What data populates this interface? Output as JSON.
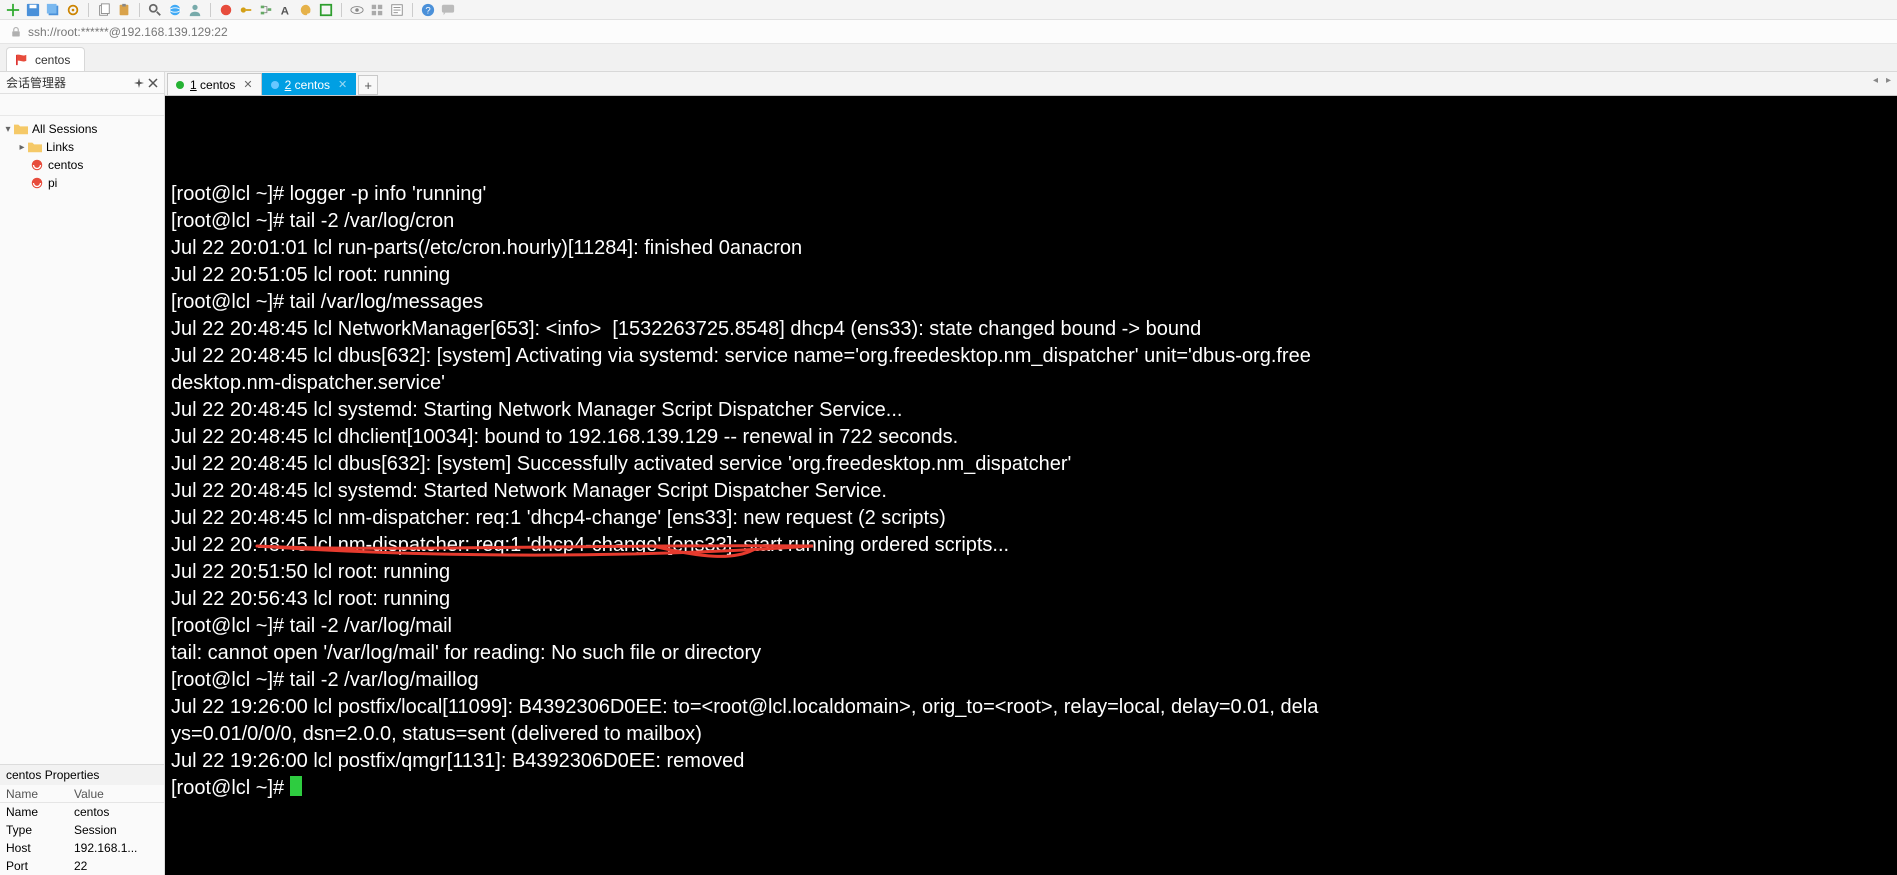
{
  "toolbar_icons": [
    "plus-icon",
    "floppy-icon",
    "floppy-multi-icon",
    "settings-icon",
    "copy-icon",
    "paste-icon",
    "find-icon",
    "globe-icon",
    "users-icon",
    "power-red-icon",
    "key-icon",
    "tree-icon",
    "font-icon",
    "palette-icon",
    "maximize-icon",
    "eye-icon",
    "grid-icon",
    "script-icon",
    "help-icon",
    "chat-icon"
  ],
  "address": {
    "text": "ssh://root:******@192.168.139.129:22"
  },
  "big_tab": {
    "label": "centos"
  },
  "session_manager": {
    "title": "会话管理器",
    "filter_placeholder": "",
    "tree": {
      "root": "All Sessions",
      "links": "Links",
      "items": [
        "centos",
        "pi"
      ]
    }
  },
  "properties": {
    "title": "centos Properties",
    "columns": {
      "name": "Name",
      "value": "Value"
    },
    "rows": [
      {
        "name": "Name",
        "value": "centos"
      },
      {
        "name": "Type",
        "value": "Session"
      },
      {
        "name": "Host",
        "value": "192.168.1..."
      },
      {
        "name": "Port",
        "value": "22"
      }
    ]
  },
  "inner_tabs": {
    "items": [
      {
        "hotkey": "1",
        "label": "centos",
        "active": false
      },
      {
        "hotkey": "2",
        "label": "centos",
        "active": true
      }
    ],
    "new": "+"
  },
  "terminal": {
    "lines": [
      "[root@lcl ~]# logger -p info 'running'",
      "[root@lcl ~]# tail -2 /var/log/cron",
      "Jul 22 20:01:01 lcl run-parts(/etc/cron.hourly)[11284]: finished 0anacron",
      "Jul 22 20:51:05 lcl root: running",
      "[root@lcl ~]# tail /var/log/messages",
      "Jul 22 20:48:45 lcl NetworkManager[653]: <info>  [1532263725.8548] dhcp4 (ens33): state changed bound -> bound",
      "Jul 22 20:48:45 lcl dbus[632]: [system] Activating via systemd: service name='org.freedesktop.nm_dispatcher' unit='dbus-org.freedesktop.nm-dispatcher.service'",
      "Jul 22 20:48:45 lcl systemd: Starting Network Manager Script Dispatcher Service...",
      "Jul 22 20:48:45 lcl dhclient[10034]: bound to 192.168.139.129 -- renewal in 722 seconds.",
      "Jul 22 20:48:45 lcl dbus[632]: [system] Successfully activated service 'org.freedesktop.nm_dispatcher'",
      "Jul 22 20:48:45 lcl systemd: Started Network Manager Script Dispatcher Service.",
      "Jul 22 20:48:45 lcl nm-dispatcher: req:1 'dhcp4-change' [ens33]: new request (2 scripts)",
      "Jul 22 20:48:45 lcl nm-dispatcher: req:1 'dhcp4-change' [ens33]: start running ordered scripts...",
      "Jul 22 20:51:50 lcl root: running",
      "Jul 22 20:56:43 lcl root: running",
      "[root@lcl ~]# tail -2 /var/log/mail",
      "tail: cannot open '/var/log/mail' for reading: No such file or directory",
      "[root@lcl ~]# tail -2 /var/log/maillog",
      "Jul 22 19:26:00 lcl postfix/local[11099]: B4392306D0EE: to=<root@lcl.localdomain>, orig_to=<root>, relay=local, delay=0.01, delays=0.01/0/0/0, dsn=2.0.0, status=sent (delivered to mailbox)",
      "Jul 22 19:26:00 lcl postfix/qmgr[1131]: B4392306D0EE: removed",
      "[root@lcl ~]# "
    ]
  }
}
